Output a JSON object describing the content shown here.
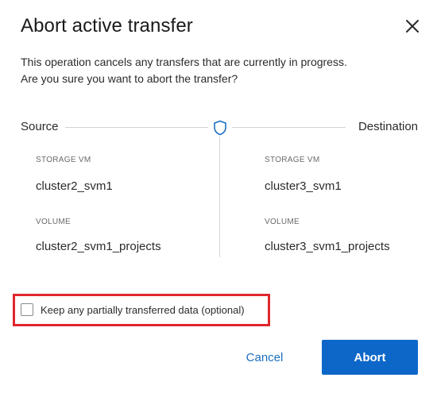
{
  "dialog": {
    "title": "Abort active transfer",
    "description_line1": "This operation cancels any transfers that are currently in progress.",
    "description_line2": "Are you sure you want to abort the transfer?",
    "close_icon": "close-icon"
  },
  "route": {
    "source_label": "Source",
    "destination_label": "Destination",
    "icon": "shield-icon"
  },
  "source": {
    "storage_vm_label": "STORAGE VM",
    "storage_vm_value": "cluster2_svm1",
    "volume_label": "VOLUME",
    "volume_value": "cluster2_svm1_projects"
  },
  "destination": {
    "storage_vm_label": "STORAGE VM",
    "storage_vm_value": "cluster3_svm1",
    "volume_label": "VOLUME",
    "volume_value": "cluster3_svm1_projects"
  },
  "options": {
    "keep_data_label": "Keep any partially transferred data (optional)",
    "keep_data_checked": false
  },
  "actions": {
    "cancel_label": "Cancel",
    "abort_label": "Abort"
  },
  "colors": {
    "primary": "#0d67c9",
    "link": "#1a6fc1",
    "highlight": "#e0262e",
    "divider": "#d4d4d4"
  }
}
